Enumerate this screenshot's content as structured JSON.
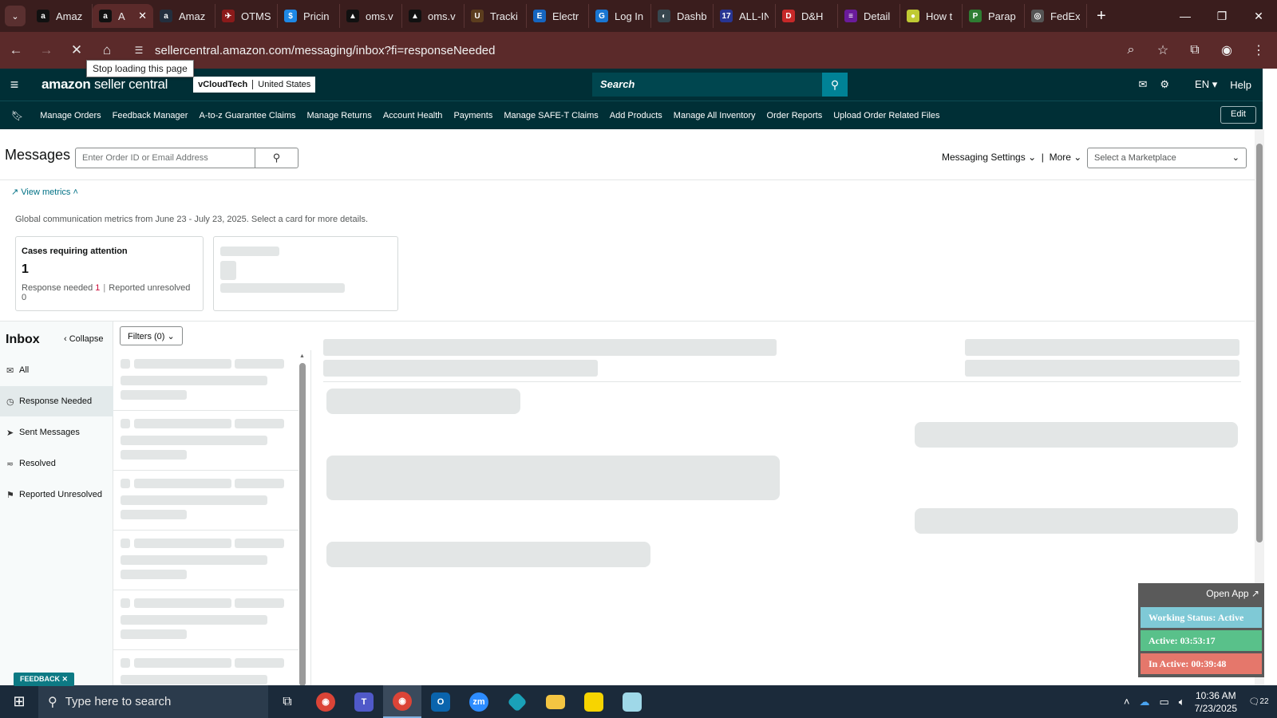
{
  "browser": {
    "tabs": [
      {
        "title": "Amaz",
        "favicon_color": "#111111",
        "favicon_glyph": "a",
        "icon": "amazon-icon"
      },
      {
        "title": "A",
        "favicon_color": "#111111",
        "favicon_glyph": "a",
        "icon": "amazon-icon",
        "active": true
      },
      {
        "title": "Amaz",
        "favicon_color": "#232f3e",
        "favicon_glyph": "a",
        "icon": "amazon-icon"
      },
      {
        "title": "OTMS",
        "favicon_color": "#8b1a1a",
        "favicon_glyph": "✈",
        "icon": "otms-icon"
      },
      {
        "title": "Pricin",
        "favicon_color": "#1e88e5",
        "favicon_glyph": "$",
        "icon": "pricing-icon"
      },
      {
        "title": "oms.v",
        "favicon_color": "#111111",
        "favicon_glyph": "▲",
        "icon": "oms-icon"
      },
      {
        "title": "oms.v",
        "favicon_color": "#111111",
        "favicon_glyph": "▲",
        "icon": "oms-icon"
      },
      {
        "title": "Tracki",
        "favicon_color": "#5c3d1e",
        "favicon_glyph": "U",
        "icon": "ups-icon"
      },
      {
        "title": "Electr",
        "favicon_color": "#1565c0",
        "favicon_glyph": "E",
        "icon": "electronics-icon"
      },
      {
        "title": "Log In",
        "favicon_color": "#1976d2",
        "favicon_glyph": "G",
        "icon": "login-icon"
      },
      {
        "title": "Dashb",
        "favicon_color": "#37474f",
        "favicon_glyph": "◐",
        "icon": "dashboard-icon"
      },
      {
        "title": "ALL-IN",
        "favicon_color": "#283593",
        "favicon_glyph": "17",
        "icon": "track17-icon"
      },
      {
        "title": "D&H",
        "favicon_color": "#c62828",
        "favicon_glyph": "D",
        "icon": "dh-icon"
      },
      {
        "title": "Detail",
        "favicon_color": "#6a1b9a",
        "favicon_glyph": "≡",
        "icon": "detail-icon"
      },
      {
        "title": "How t",
        "favicon_color": "#c0ca33",
        "favicon_glyph": "●",
        "icon": "howto-icon"
      },
      {
        "title": "Parap",
        "favicon_color": "#2e7d32",
        "favicon_glyph": "P",
        "icon": "sheets-icon"
      },
      {
        "title": "FedEx",
        "favicon_color": "#555555",
        "favicon_glyph": "◎",
        "icon": "fedex-icon"
      }
    ],
    "url": "sellercentral.amazon.com/messaging/inbox?fi=responseNeeded",
    "tooltip": "Stop loading this page"
  },
  "header": {
    "logo_main": "amazon",
    "logo_sub": "seller central",
    "store_name": "vCloudTech",
    "marketplace": "United States",
    "search_placeholder": "Search",
    "language": "EN",
    "help": "Help"
  },
  "nav": {
    "items": [
      "Manage Orders",
      "Feedback Manager",
      "A-to-z Guarantee Claims",
      "Manage Returns",
      "Account Health",
      "Payments",
      "Manage SAFE-T Claims",
      "Add Products",
      "Manage All Inventory",
      "Order Reports",
      "Upload Order Related Files"
    ],
    "edit": "Edit"
  },
  "messages": {
    "title": "Messages",
    "search_placeholder": "Enter Order ID or Email Address",
    "settings": "Messaging Settings",
    "more": "More",
    "marketplace_select": "Select a Marketplace",
    "view_metrics": "View metrics",
    "metrics_note": "Global communication metrics from June 23 - July 23, 2025. Select a card for more details.",
    "card": {
      "title": "Cases requiring attention",
      "value": "1",
      "response_needed_label": "Response needed",
      "response_needed_value": "1",
      "reported_unresolved_label": "Reported unresolved",
      "reported_unresolved_value": "0"
    }
  },
  "inbox": {
    "title": "Inbox",
    "collapse": "Collapse",
    "filters": "Filters (0)",
    "items": [
      {
        "label": "All",
        "icon": "envelope-icon"
      },
      {
        "label": "Response Needed",
        "icon": "clock-icon",
        "selected": true
      },
      {
        "label": "Sent Messages",
        "icon": "send-icon"
      },
      {
        "label": "Resolved",
        "icon": "resolved-icon"
      },
      {
        "label": "Reported Unresolved",
        "icon": "report-icon"
      }
    ]
  },
  "widget": {
    "open_app": "Open App ↗",
    "status": "Working Status: Active",
    "active": "Active: 03:53:17",
    "inactive": "In Active: 00:39:48"
  },
  "feedback": "FEEDBACK",
  "taskbar": {
    "search_placeholder": "Type here to search",
    "time": "10:36 AM",
    "date": "7/23/2025",
    "notifications": "22"
  }
}
